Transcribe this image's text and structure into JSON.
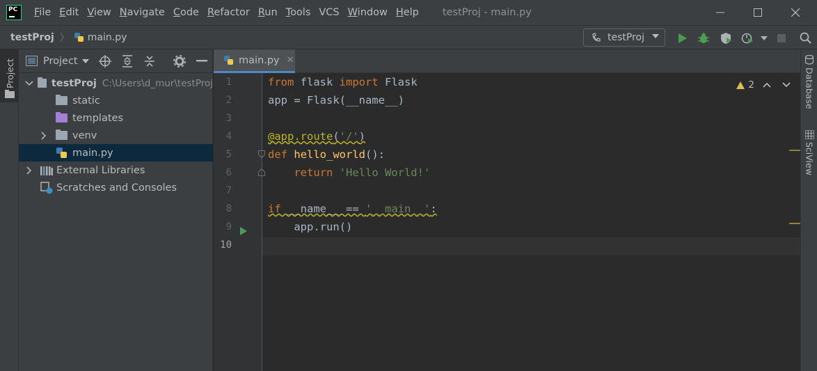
{
  "menubar": {
    "items": [
      {
        "label": "File",
        "u": "F",
        "rest": "ile"
      },
      {
        "label": "Edit",
        "u": "E",
        "rest": "dit"
      },
      {
        "label": "View",
        "u": "V",
        "rest": "iew"
      },
      {
        "label": "Navigate",
        "u": "N",
        "rest": "avigate"
      },
      {
        "label": "Code",
        "u": "C",
        "rest": "ode"
      },
      {
        "label": "Refactor",
        "u": "R",
        "rest": "efactor"
      },
      {
        "label": "Run",
        "u": "R",
        "rest": "un"
      },
      {
        "label": "Tools",
        "u": "T",
        "rest": "ools"
      },
      {
        "label": "VCS",
        "u": "",
        "rest": "VCS"
      },
      {
        "label": "Window",
        "u": "W",
        "rest": "indow"
      },
      {
        "label": "Help",
        "u": "H",
        "rest": "elp"
      }
    ],
    "window_title": "testProj - main.py",
    "logo_text": "PC"
  },
  "navbar": {
    "project": "testProj",
    "file": "main.py",
    "run_config": "testProj"
  },
  "left_strip": {
    "project_tab": "Project"
  },
  "project_panel": {
    "title": "Project",
    "tree": [
      {
        "label": "testProj",
        "hint": "C:\\Users\\d_mur\\testProj"
      },
      {
        "label": "static"
      },
      {
        "label": "templates"
      },
      {
        "label": "venv"
      },
      {
        "label": "main.py"
      },
      {
        "label": "External Libraries"
      },
      {
        "label": "Scratches and Consoles"
      }
    ]
  },
  "editor": {
    "tab": "main.py",
    "line_numbers": [
      "1",
      "2",
      "3",
      "4",
      "5",
      "6",
      "7",
      "8",
      "9",
      "10"
    ],
    "inspection_count": "2"
  },
  "right_strip": {
    "database": "Database",
    "sciview": "SciView"
  },
  "colors": {
    "keyword": "#cc7832",
    "function": "#ffc66d",
    "string": "#6a8759",
    "decorator": "#bbb529",
    "plain": "#a9b7c6",
    "run_green": "#499c54"
  }
}
